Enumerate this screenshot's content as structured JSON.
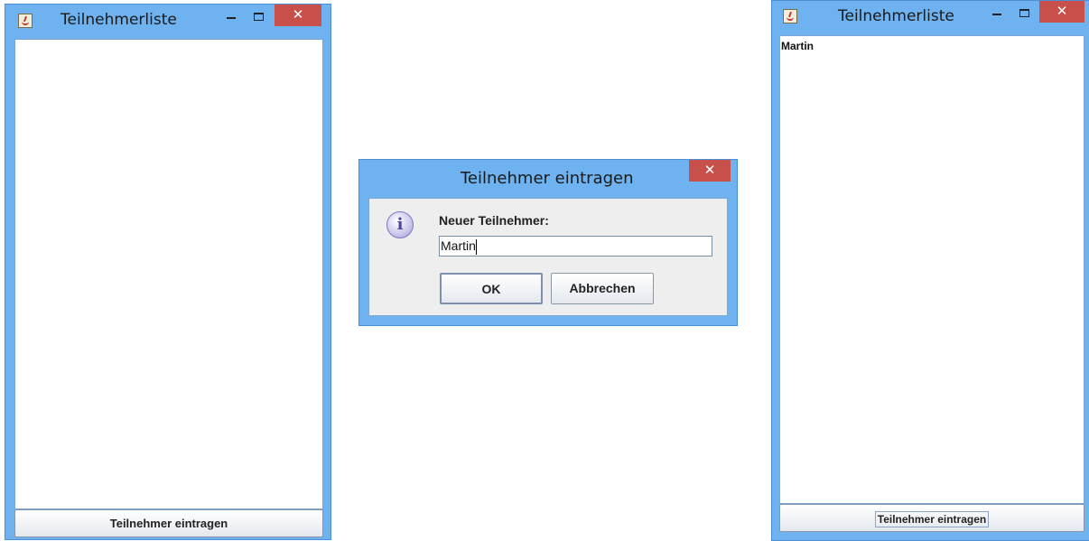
{
  "window_left": {
    "title": "Teilnehmerliste",
    "close_glyph": "✕",
    "list_items": [],
    "button_label": "Teilnehmer eintragen"
  },
  "dialog": {
    "title": "Teilnehmer eintragen",
    "close_glyph": "✕",
    "info_glyph": "i",
    "label": "Neuer Teilnehmer:",
    "input_value": "Martin",
    "ok_label": "OK",
    "cancel_label": "Abbrechen"
  },
  "window_right": {
    "title": "Teilnehmerliste",
    "close_glyph": "✕",
    "list_items": [
      "Martin"
    ],
    "button_label": "Teilnehmer eintragen"
  },
  "icons": {
    "app": "java-coffee-icon",
    "minimize": "minimize-icon",
    "maximize": "maximize-icon",
    "close": "close-icon",
    "info": "info-icon"
  },
  "colors": {
    "frame": "#6eb2f0",
    "close_button": "#c7504a"
  }
}
